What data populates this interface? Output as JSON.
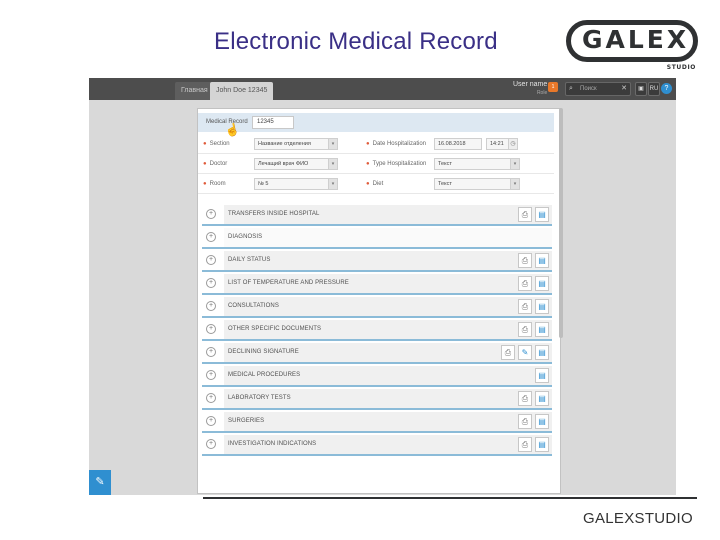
{
  "slide": {
    "title": "Electronic Medical Record",
    "footer_brand": "GALEXSTUDIO"
  },
  "logo": {
    "name": "GALEX",
    "sub": "STUDIO"
  },
  "topbar": {
    "tabs": [
      {
        "label": "Главная"
      },
      {
        "label": "John Doe 12345"
      }
    ],
    "user_name": "User name",
    "user_role": "Role",
    "notifications": "1",
    "search_placeholder": "Поиск",
    "search_icon": "search-icon",
    "lang": "RU",
    "help": "?"
  },
  "record": {
    "label": "Medical Record",
    "value": "12345",
    "fields": [
      {
        "label": "Section",
        "value": "Название отделения",
        "side": "left"
      },
      {
        "label": "Date Hospitalization",
        "date": "16.08.2018",
        "time": "14:21",
        "side": "right"
      },
      {
        "label": "Doctor",
        "value": "Лечащий врач ФИО",
        "side": "left"
      },
      {
        "label": "Type Hospitalization",
        "value": "Текст",
        "side": "right"
      },
      {
        "label": "Room",
        "value": "№ 5",
        "side": "left"
      },
      {
        "label": "Diet",
        "value": "Текст",
        "side": "right"
      }
    ]
  },
  "sections": [
    {
      "label": "TRANSFERS INSIDE HOSPITAL",
      "print": true,
      "doc": true
    },
    {
      "label": "DIAGNOSIS",
      "print": false,
      "doc": false
    },
    {
      "label": "DAILY STATUS",
      "print": true,
      "doc": true
    },
    {
      "label": "LIST OF TEMPERATURE AND PRESSURE",
      "print": true,
      "doc": true
    },
    {
      "label": "CONSULTATIONS",
      "print": true,
      "doc": true
    },
    {
      "label": "OTHER SPECIFIC DOCUMENTS",
      "print": true,
      "doc": true
    },
    {
      "label": "DECLINING SIGNATURE",
      "print": true,
      "doc": true,
      "extra_doc": true
    },
    {
      "label": "MEDICAL PROCEDURES",
      "print": false,
      "doc": true
    },
    {
      "label": "LABORATORY TESTS",
      "print": true,
      "doc": true
    },
    {
      "label": "SURGERIES",
      "print": true,
      "doc": true
    },
    {
      "label": "INVESTIGATION INDICATIONS",
      "print": true,
      "doc": true
    }
  ],
  "icons": {
    "expand": "plus-circle-icon",
    "print": "printer-icon",
    "doc": "document-icon",
    "edit": "edit-document-icon"
  },
  "colors": {
    "title": "#3a2f86",
    "accent": "#2f8fd0",
    "topbar": "#4d4d4d",
    "required": "#e05b3a"
  }
}
